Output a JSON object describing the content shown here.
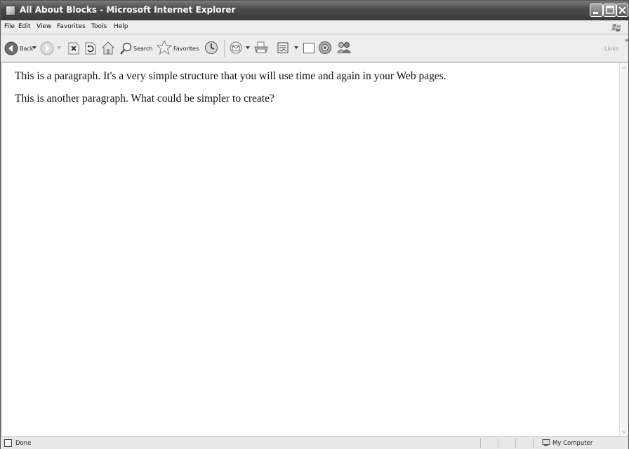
{
  "window": {
    "title": "All About Blocks - Microsoft Internet Explorer"
  },
  "menu": {
    "items": [
      "File",
      "Edit",
      "View",
      "Favorites",
      "Tools",
      "Help"
    ]
  },
  "toolbar": {
    "back_label": "Back",
    "search_label": "Search",
    "favorites_label": "Favorites",
    "links_label": "Links",
    "chevron": "»"
  },
  "content": {
    "paragraphs": [
      "This is a paragraph. It's a very simple structure that you will use time and again in your Web pages.",
      "This is another paragraph. What could be simpler to create?"
    ]
  },
  "status": {
    "text": "Done",
    "zone": "My Computer"
  },
  "icons": {
    "back": "back-arrow-icon",
    "forward": "forward-arrow-icon",
    "stop": "stop-icon",
    "refresh": "refresh-icon",
    "home": "home-icon",
    "search": "magnifier-icon",
    "favorites": "star-icon",
    "history": "history-icon",
    "mail": "mail-icon",
    "print": "print-icon",
    "edit": "edit-icon",
    "discuss": "discuss-icon",
    "research": "research-icon",
    "messenger": "messenger-icon"
  }
}
